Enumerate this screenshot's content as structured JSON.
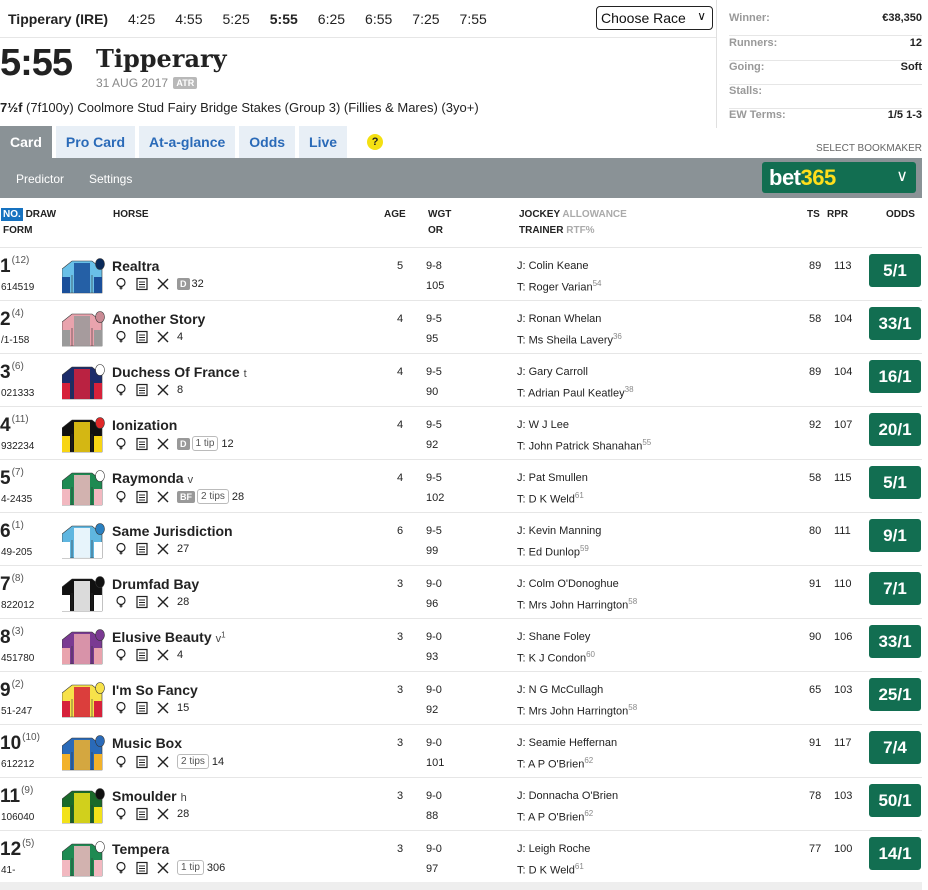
{
  "topbar": {
    "course": "Tipperary (IRE)",
    "times": [
      "4:25",
      "4:55",
      "5:25",
      "5:55",
      "6:25",
      "6:55",
      "7:25",
      "7:55"
    ],
    "active_time": "5:55",
    "choose_race": "Choose Race"
  },
  "info": {
    "winner_label": "Winner:",
    "winner_value": "€38,350",
    "runners_label": "Runners:",
    "runners_value": "12",
    "going_label": "Going:",
    "going_value": "Soft",
    "stalls_label": "Stalls:",
    "stalls_value": "",
    "ew_label": "EW Terms:",
    "ew_value": "1/5 1-3"
  },
  "race": {
    "time": "5:55",
    "course": "Tipperary",
    "date": "31 AUG 2017",
    "atr": "ATR",
    "distance": "7½f",
    "description": " (7f100y) Coolmore Stud Fairy Bridge Stakes (Group 3) (Fillies & Mares) (3yo+)"
  },
  "tabs": [
    "Card",
    "Pro Card",
    "At-a-glance",
    "Odds",
    "Live"
  ],
  "help": "?",
  "select_bookmaker": "SELECT BOOKMAKER",
  "subbar": {
    "predictor": "Predictor",
    "settings": "Settings",
    "bookmaker_a": "bet",
    "bookmaker_b": "365"
  },
  "headers": {
    "no": "NO.",
    "draw": "DRAW",
    "form": "FORM",
    "horse": "HORSE",
    "age": "AGE",
    "wgt": "WGT",
    "or": "OR",
    "jockey": "JOCKEY",
    "allowance": "ALLOWANCE",
    "trainer": "TRAINER",
    "rtf": "RTF%",
    "ts": "TS",
    "rpr": "RPR",
    "odds": "ODDS"
  },
  "runners": [
    {
      "no": "1",
      "draw": "(12)",
      "form": "614519",
      "horse": "Realtra",
      "gear": "",
      "gear_sup": "",
      "badge": "D",
      "tips": "",
      "days": "32",
      "age": "5",
      "wgt": "9-8",
      "or": "105",
      "jockey": "J: Colin Keane",
      "trainer": "T: Roger Varian",
      "rtf": "54",
      "ts": "89",
      "rpr": "113",
      "odds": "5/1",
      "silk": [
        "#69c0e8",
        "#1a4f9a",
        "#0a2a5a"
      ]
    },
    {
      "no": "2",
      "draw": "(4)",
      "form": "/1-158",
      "horse": "Another Story",
      "gear": "",
      "gear_sup": "",
      "badge": "",
      "tips": "",
      "days": "4",
      "age": "4",
      "wgt": "9-5",
      "or": "95",
      "jockey": "J: Ronan Whelan",
      "trainer": "T: Ms Sheila Lavery",
      "rtf": "36",
      "ts": "58",
      "rpr": "104",
      "odds": "33/1",
      "silk": [
        "#e9a3ad",
        "#9a9a9a",
        "#c98a94"
      ]
    },
    {
      "no": "3",
      "draw": "(6)",
      "form": "021333",
      "horse": "Duchess Of France",
      "gear": "t",
      "gear_sup": "",
      "badge": "",
      "tips": "",
      "days": "8",
      "age": "4",
      "wgt": "9-5",
      "or": "90",
      "jockey": "J: Gary Carroll",
      "trainer": "T: Adrian Paul Keatley",
      "rtf": "38",
      "ts": "89",
      "rpr": "104",
      "odds": "16/1",
      "silk": [
        "#1c2c6a",
        "#d6213a",
        "#ffffff"
      ]
    },
    {
      "no": "4",
      "draw": "(11)",
      "form": "932234",
      "horse": "Ionization",
      "gear": "",
      "gear_sup": "",
      "badge": "D",
      "tips": "1 tip",
      "days": "12",
      "age": "4",
      "wgt": "9-5",
      "or": "92",
      "jockey": "J: W J Lee",
      "trainer": "T: John Patrick Shanahan",
      "rtf": "55",
      "ts": "92",
      "rpr": "107",
      "odds": "20/1",
      "silk": [
        "#111111",
        "#f7d514",
        "#e02828"
      ]
    },
    {
      "no": "5",
      "draw": "(7)",
      "form": "4-2435",
      "horse": "Raymonda",
      "gear": "v",
      "gear_sup": "",
      "badge": "BF",
      "tips": "2 tips",
      "days": "28",
      "age": "4",
      "wgt": "9-5",
      "or": "102",
      "jockey": "J: Pat Smullen",
      "trainer": "T: D K Weld",
      "rtf": "61",
      "ts": "58",
      "rpr": "115",
      "odds": "5/1",
      "silk": [
        "#1e8a52",
        "#f2b8c0",
        "#ffffff"
      ]
    },
    {
      "no": "6",
      "draw": "(1)",
      "form": "49-205",
      "horse": "Same Jurisdiction",
      "gear": "",
      "gear_sup": "",
      "badge": "",
      "tips": "",
      "days": "27",
      "age": "6",
      "wgt": "9-5",
      "or": "99",
      "jockey": "J: Kevin Manning",
      "trainer": "T: Ed Dunlop",
      "rtf": "59",
      "ts": "80",
      "rpr": "111",
      "odds": "9/1",
      "silk": [
        "#5fb6e0",
        "#ffffff",
        "#2a80c0"
      ]
    },
    {
      "no": "7",
      "draw": "(8)",
      "form": "822012",
      "horse": "Drumfad Bay",
      "gear": "",
      "gear_sup": "",
      "badge": "",
      "tips": "",
      "days": "28",
      "age": "3",
      "wgt": "9-0",
      "or": "96",
      "jockey": "J: Colm O'Donoghue",
      "trainer": "T: Mrs John Harrington",
      "rtf": "58",
      "ts": "91",
      "rpr": "110",
      "odds": "7/1",
      "silk": [
        "#111111",
        "#ffffff",
        "#111111"
      ]
    },
    {
      "no": "8",
      "draw": "(3)",
      "form": "451780",
      "horse": "Elusive Beauty",
      "gear": "v",
      "gear_sup": "1",
      "badge": "",
      "tips": "",
      "days": "4",
      "age": "3",
      "wgt": "9-0",
      "or": "93",
      "jockey": "J: Shane Foley",
      "trainer": "T: K J Condon",
      "rtf": "60",
      "ts": "90",
      "rpr": "106",
      "odds": "33/1",
      "silk": [
        "#7a3a92",
        "#e9a3ad",
        "#7a3a92"
      ]
    },
    {
      "no": "9",
      "draw": "(2)",
      "form": "51-247",
      "horse": "I'm So Fancy",
      "gear": "",
      "gear_sup": "",
      "badge": "",
      "tips": "",
      "days": "15",
      "age": "3",
      "wgt": "9-0",
      "or": "92",
      "jockey": "J: N G McCullagh",
      "trainer": "T: Mrs John Harrington",
      "rtf": "58",
      "ts": "65",
      "rpr": "103",
      "odds": "25/1",
      "silk": [
        "#f7e24a",
        "#d6213a",
        "#f7e24a"
      ]
    },
    {
      "no": "10",
      "draw": "(10)",
      "form": "612212",
      "horse": "Music Box",
      "gear": "",
      "gear_sup": "",
      "badge": "",
      "tips": "2 tips",
      "days": "14",
      "age": "3",
      "wgt": "9-0",
      "or": "101",
      "jockey": "J: Seamie Heffernan",
      "trainer": "T: A P O'Brien",
      "rtf": "62",
      "ts": "91",
      "rpr": "117",
      "odds": "7/4",
      "silk": [
        "#2a6ab8",
        "#f2b22a",
        "#2a6ab8"
      ]
    },
    {
      "no": "11",
      "draw": "(9)",
      "form": "106040",
      "horse": "Smoulder",
      "gear": "h",
      "gear_sup": "",
      "badge": "",
      "tips": "",
      "days": "28",
      "age": "3",
      "wgt": "9-0",
      "or": "88",
      "jockey": "J: Donnacha O'Brien",
      "trainer": "T: A P O'Brien",
      "rtf": "62",
      "ts": "78",
      "rpr": "103",
      "odds": "50/1",
      "silk": [
        "#1a6a2a",
        "#f2e21a",
        "#111111"
      ]
    },
    {
      "no": "12",
      "draw": "(5)",
      "form": "41-",
      "horse": "Tempera",
      "gear": "",
      "gear_sup": "",
      "badge": "",
      "tips": "1 tip",
      "days": "306",
      "age": "3",
      "wgt": "9-0",
      "or": "97",
      "jockey": "J: Leigh Roche",
      "trainer": "T: D K Weld",
      "rtf": "61",
      "ts": "77",
      "rpr": "100",
      "odds": "14/1",
      "silk": [
        "#1e8a52",
        "#f2b8c0",
        "#ffffff"
      ]
    }
  ],
  "colors": {
    "odds_green": "#126e51",
    "tab_blue": "#2a6ab8",
    "subbar_grey": "#8a9296",
    "bet365_yellow": "#ffdf1b"
  }
}
